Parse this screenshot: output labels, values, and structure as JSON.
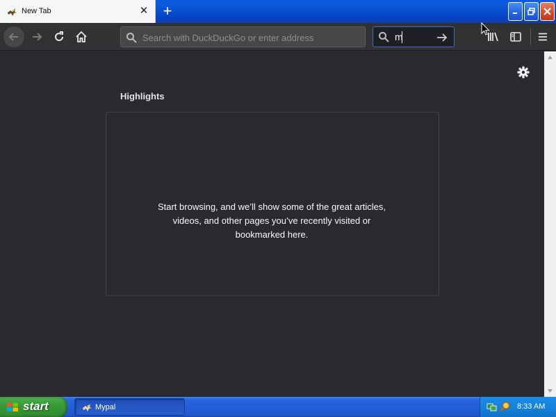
{
  "window": {
    "tab": {
      "title": "New Tab"
    },
    "colors": {
      "accent": "#0a5be0",
      "close": "#d2492a"
    }
  },
  "toolbar": {
    "url_placeholder": "Search with DuckDuckGo or enter address",
    "search_value": "m"
  },
  "content": {
    "section_title": "Highlights",
    "empty_message": "Start browsing, and we’ll show some of the great articles, videos, and other pages you’ve recently visited or bookmarked here."
  },
  "taskbar": {
    "start_label": "start",
    "task_label": "Mypal",
    "clock": "8:33 AM"
  }
}
